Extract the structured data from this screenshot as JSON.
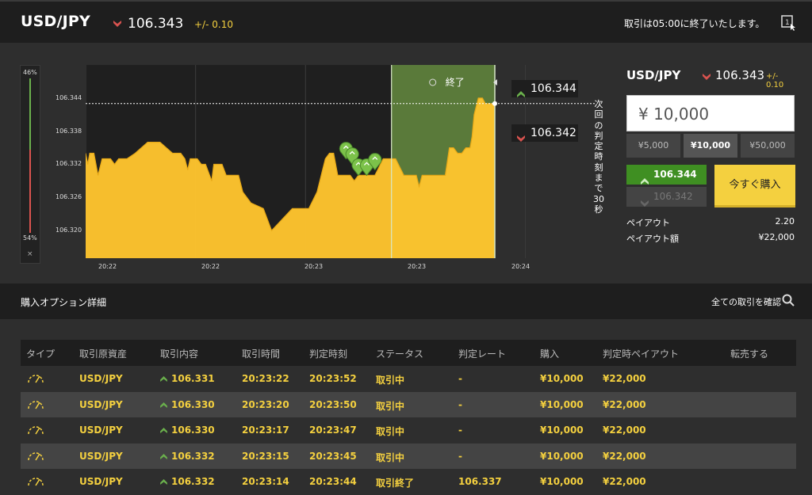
{
  "header": {
    "pair": "USD/JPY",
    "price": "106.343",
    "change": "+/- 0.10",
    "notice": "取引は05:00に終了いたします。",
    "tutorial_icon": "tutorial-icon"
  },
  "gauge": {
    "top_pct": "46%",
    "bottom_pct": "54%",
    "close": "×",
    "high_fraction": 0.46
  },
  "chart_data": {
    "type": "area",
    "y_ticks": [
      "106.344",
      "106.338",
      "106.332",
      "106.326",
      "106.320"
    ],
    "x_ticks": [
      "20:22",
      "20:22",
      "20:23",
      "20:23",
      "20:24"
    ],
    "ylim": [
      106.315,
      106.35
    ],
    "x": [
      0,
      0.5,
      1,
      2,
      3,
      4,
      6,
      7,
      8,
      10,
      12,
      15,
      18,
      21,
      22,
      23,
      24,
      24.7,
      25.3,
      26,
      27,
      28,
      29,
      30,
      30.5,
      31,
      32,
      33,
      34,
      35,
      37,
      38,
      40,
      43,
      45,
      50,
      54,
      56,
      57,
      58,
      59,
      60,
      61,
      62,
      63,
      64,
      65,
      66,
      67,
      69,
      70,
      72,
      75,
      77,
      78,
      80,
      80.7,
      81.4,
      82,
      83,
      84,
      86,
      87,
      88,
      89,
      90,
      91,
      92,
      93,
      93.5,
      94,
      95,
      96,
      96.7,
      97,
      98,
      98.6,
      99
    ],
    "y": [
      106.334,
      106.332,
      106.334,
      106.334,
      106.33,
      106.333,
      106.333,
      106.332,
      106.333,
      106.333,
      106.334,
      106.336,
      106.336,
      106.334,
      106.334,
      106.334,
      106.333,
      106.331,
      106.333,
      106.333,
      106.333,
      106.332,
      106.332,
      106.33,
      106.329,
      106.332,
      106.332,
      106.332,
      106.33,
      106.33,
      106.33,
      106.327,
      106.325,
      106.324,
      106.32,
      106.324,
      106.324,
      106.327,
      106.33,
      106.333,
      106.334,
      106.334,
      106.33,
      106.33,
      106.33,
      106.33,
      106.329,
      106.33,
      106.33,
      106.33,
      106.33,
      106.333,
      106.333,
      106.33,
      106.33,
      106.33,
      106.328,
      106.33,
      106.33,
      106.33,
      106.33,
      106.33,
      106.33,
      106.335,
      106.335,
      106.334,
      106.334,
      106.335,
      106.335,
      106.337,
      106.341,
      106.344,
      106.344,
      106.343,
      106.343,
      106.343,
      106.343,
      106.343
    ],
    "current": 106.343,
    "markers": [
      {
        "x": 63,
        "y": 106.333
      },
      {
        "x": 64.5,
        "y": 106.332
      },
      {
        "x": 66,
        "y": 106.33
      },
      {
        "x": 68,
        "y": 106.33
      },
      {
        "x": 70,
        "y": 106.331
      }
    ],
    "closed_range": [
      74,
      99
    ],
    "closed_label": "終了",
    "grid": true
  },
  "tags": {
    "high": "106.344",
    "low": "106.342"
  },
  "next_judge": "次回の判定時刻まで30秒",
  "order": {
    "pair": "USD/JPY",
    "price": "106.343",
    "change": "+/- 0.10",
    "amount": "¥ 10,000",
    "presets": [
      "¥5,000",
      "¥10,000",
      "¥50,000"
    ],
    "high_label": "106.344",
    "low_label": "106.342",
    "buy_now": "今すぐ購入",
    "payout_label": "ペイアウト",
    "payout_value": "2.20",
    "payout_amount_label": "ペイアウト額",
    "payout_amount_value": "¥22,000"
  },
  "section": {
    "title": "購入オプション詳細",
    "all_trades": "全ての取引を確認"
  },
  "table": {
    "headers": [
      "タイプ",
      "取引原資産",
      "取引内容",
      "取引時間",
      "判定時刻",
      "ステータス",
      "判定レート",
      "購入",
      "判定時ペイアウト",
      "転売する"
    ],
    "rows": [
      {
        "pair": "USD/JPY",
        "rate": "106.331",
        "time": "20:23:22",
        "judge": "20:23:52",
        "status": "取引中",
        "judge_rate": "-",
        "buy": "¥10,000",
        "payout": "¥22,000"
      },
      {
        "pair": "USD/JPY",
        "rate": "106.330",
        "time": "20:23:20",
        "judge": "20:23:50",
        "status": "取引中",
        "judge_rate": "-",
        "buy": "¥10,000",
        "payout": "¥22,000"
      },
      {
        "pair": "USD/JPY",
        "rate": "106.330",
        "time": "20:23:17",
        "judge": "20:23:47",
        "status": "取引中",
        "judge_rate": "-",
        "buy": "¥10,000",
        "payout": "¥22,000"
      },
      {
        "pair": "USD/JPY",
        "rate": "106.332",
        "time": "20:23:15",
        "judge": "20:23:45",
        "status": "取引中",
        "judge_rate": "-",
        "buy": "¥10,000",
        "payout": "¥22,000"
      },
      {
        "pair": "USD/JPY",
        "rate": "106.332",
        "time": "20:23:14",
        "judge": "20:23:44",
        "status": "取引終了",
        "judge_rate": "106.337",
        "buy": "¥10,000",
        "payout": "¥22,000"
      }
    ]
  },
  "colors": {
    "accent": "#f4d03f",
    "up": "#6ab04c",
    "down": "#d9534f",
    "closed": "#5a7a3a"
  }
}
